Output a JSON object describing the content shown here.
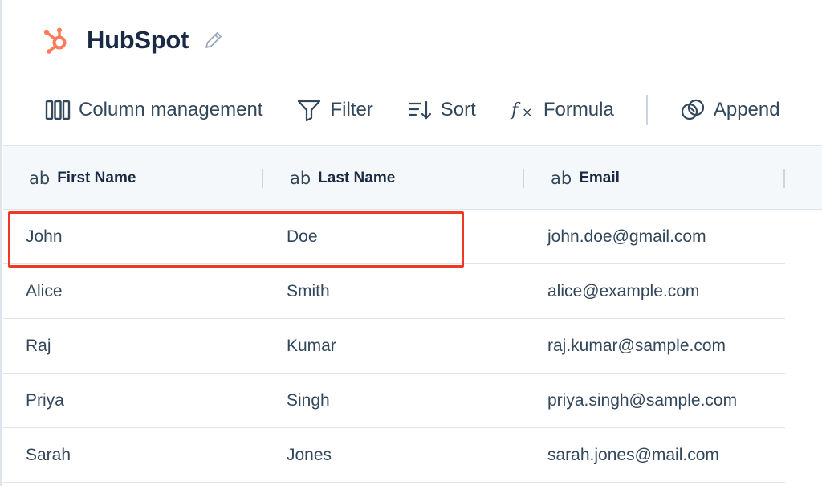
{
  "app": {
    "title": "HubSpot",
    "logo_icon": "hubspot-sprocket-icon",
    "brand_color": "#ff7a59"
  },
  "toolbar": {
    "items": [
      {
        "label": "Column management",
        "icon": "columns-icon"
      },
      {
        "label": "Filter",
        "icon": "filter-icon"
      },
      {
        "label": "Sort",
        "icon": "sort-icon"
      },
      {
        "label": "Formula",
        "icon": "formula-icon"
      },
      {
        "label": "Append",
        "icon": "append-icon"
      }
    ]
  },
  "table": {
    "columns": [
      {
        "type_label": "ab",
        "label": "First Name"
      },
      {
        "type_label": "ab",
        "label": "Last Name"
      },
      {
        "type_label": "ab",
        "label": "Email"
      }
    ],
    "rows": [
      [
        "John",
        "Doe",
        "john.doe@gmail.com"
      ],
      [
        "Alice",
        "Smith",
        "alice@example.com"
      ],
      [
        "Raj",
        "Kumar",
        "raj.kumar@sample.com"
      ],
      [
        "Priya",
        "Singh",
        "priya.singh@sample.com"
      ],
      [
        "Sarah",
        "Jones",
        "sarah.jones@mail.com"
      ]
    ]
  },
  "highlight": {
    "color": "#ee3a24",
    "row_index": 0
  }
}
